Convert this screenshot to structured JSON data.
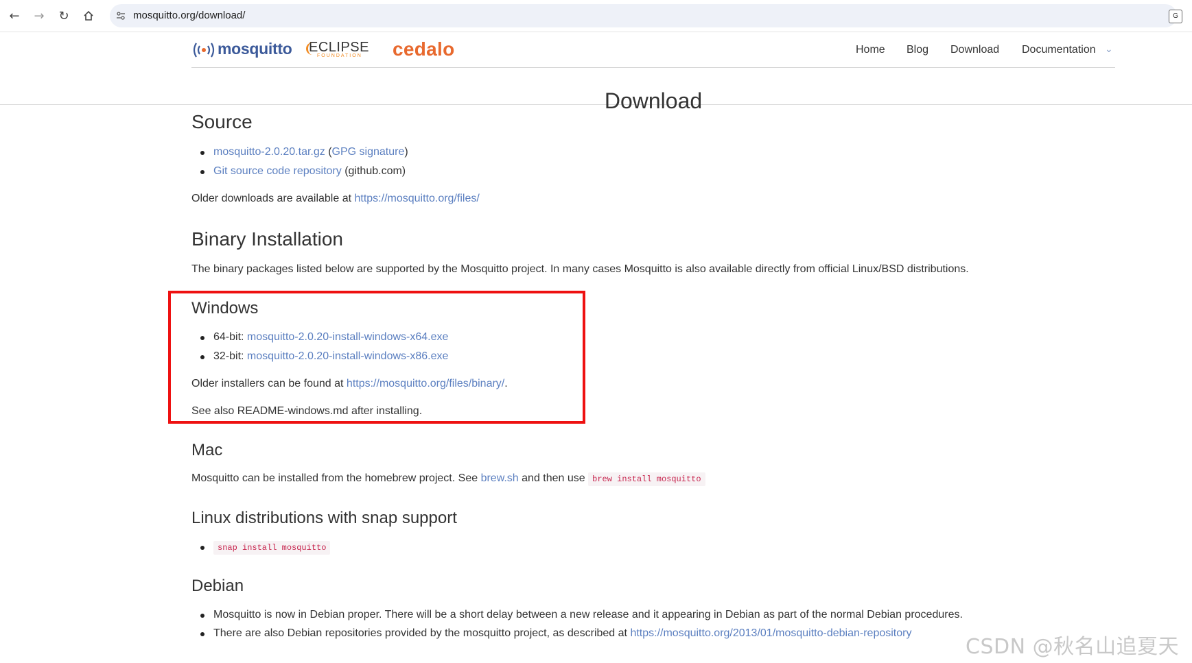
{
  "browser": {
    "url": "mosquitto.org/download/",
    "translate_glyph": "G"
  },
  "header": {
    "logo_mosquitto": "mosquitto",
    "logo_eclipse": "ECLIPSE",
    "logo_eclipse_sub": "FOUNDATION",
    "logo_cedalo": "cedalo",
    "nav": [
      "Home",
      "Blog",
      "Download",
      "Documentation"
    ],
    "page_title": "Download"
  },
  "source": {
    "heading": "Source",
    "tarball_link": "mosquitto-2.0.20.tar.gz",
    "gpg_link": "GPG signature",
    "git_link": "Git source code repository",
    "git_suffix": "(github.com)",
    "older_text": "Older downloads are available at",
    "older_link": "https://mosquitto.org/files/"
  },
  "binary": {
    "heading": "Binary Installation",
    "intro": "The binary packages listed below are supported by the Mosquitto project. In many cases Mosquitto is also available directly from official Linux/BSD distributions."
  },
  "windows": {
    "heading": "Windows",
    "x64_label": "64-bit:",
    "x64_link": "mosquitto-2.0.20-install-windows-x64.exe",
    "x86_label": "32-bit:",
    "x86_link": "mosquitto-2.0.20-install-windows-x86.exe",
    "older_text": "Older installers can be found at",
    "older_link": "https://mosquitto.org/files/binary/",
    "readme_text": "See also README-windows.md after installing."
  },
  "mac": {
    "heading": "Mac",
    "text_before": "Mosquitto can be installed from the homebrew project. See",
    "brew_link": "brew.sh",
    "text_after": "and then use",
    "command": "brew install mosquitto"
  },
  "snap": {
    "heading": "Linux distributions with snap support",
    "command": "snap install mosquitto"
  },
  "debian": {
    "heading": "Debian",
    "item1": "Mosquitto is now in Debian proper. There will be a short delay between a new release and it appearing in Debian as part of the normal Debian procedures.",
    "item2_text": "There are also Debian repositories provided by the mosquitto project, as described at",
    "item2_link": "https://mosquitto.org/2013/01/mosquitto-debian-repository"
  },
  "watermark": "CSDN @秋名山追夏天",
  "colors": {
    "link": "#5b7fc0",
    "highlight_border": "#ee1111",
    "cedalo_orange": "#e8692e",
    "mosquitto_blue": "#3c5a9a",
    "code_red": "#c7254e"
  }
}
